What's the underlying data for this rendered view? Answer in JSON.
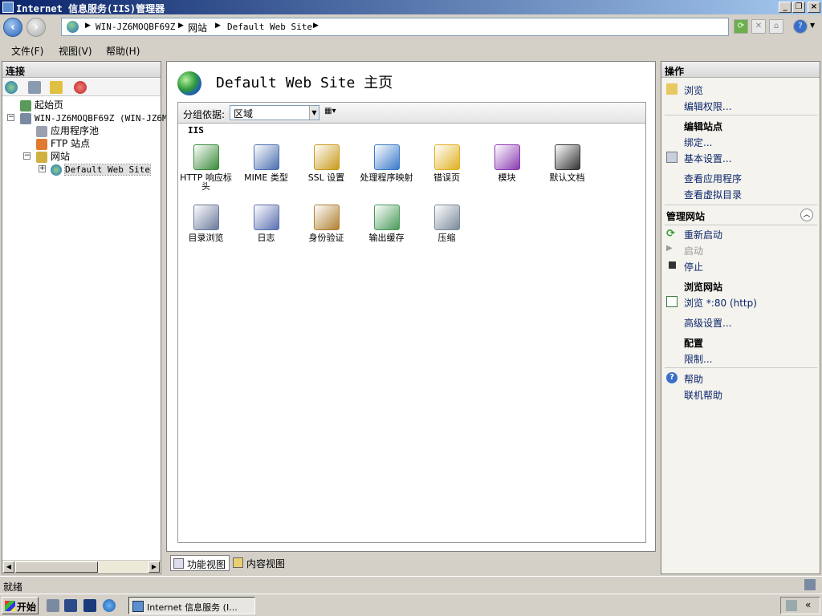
{
  "window": {
    "title": "Internet 信息服务(IIS)管理器"
  },
  "address": {
    "crumbs": [
      "WIN-JZ6MOQBF69Z",
      "网站",
      "Default Web Site"
    ],
    "sep": "▶"
  },
  "menu": {
    "file": "文件(F)",
    "view": "视图(V)",
    "help": "帮助(H)"
  },
  "left": {
    "header": "连接",
    "tree": {
      "start_page": "起始页",
      "server": "WIN-JZ6MOQBF69Z (WIN-JZ6MO",
      "app_pools": "应用程序池",
      "ftp_sites": "FTP 站点",
      "sites": "网站",
      "default_site": "Default Web Site"
    }
  },
  "center": {
    "title": "Default Web Site 主页",
    "group_label": "分组依据:",
    "group_value": "区域",
    "section": "IIS",
    "features": [
      {
        "label": "HTTP 响应标头",
        "icon": "http-response-icon",
        "color": "#3a8a3a"
      },
      {
        "label": "MIME 类型",
        "icon": "mime-icon",
        "color": "#4a6fb0"
      },
      {
        "label": "SSL 设置",
        "icon": "lock-icon",
        "color": "#c89a1a"
      },
      {
        "label": "处理程序映射",
        "icon": "handler-icon",
        "color": "#3a7ac8"
      },
      {
        "label": "错误页",
        "icon": "error-page-icon",
        "color": "#e0b020"
      },
      {
        "label": "模块",
        "icon": "modules-icon",
        "color": "#8a3ab0"
      },
      {
        "label": "默认文档",
        "icon": "default-doc-icon",
        "color": "#333333"
      },
      {
        "label": "目录浏览",
        "icon": "dir-browse-icon",
        "color": "#6a7a9a"
      },
      {
        "label": "日志",
        "icon": "log-icon",
        "color": "#5a6fb0"
      },
      {
        "label": "身份验证",
        "icon": "auth-icon",
        "color": "#b08030"
      },
      {
        "label": "输出缓存",
        "icon": "output-cache-icon",
        "color": "#4a9a5a"
      },
      {
        "label": "压缩",
        "icon": "compress-icon",
        "color": "#7a8a9a"
      }
    ],
    "tabs": {
      "features": "功能视图",
      "content": "内容视图"
    }
  },
  "actions": {
    "header": "操作",
    "browse": "浏览",
    "edit_perms": "编辑权限...",
    "edit_site_head": "编辑站点",
    "bindings": "绑定...",
    "basic_settings": "基本设置...",
    "view_apps": "查看应用程序",
    "view_vdirs": "查看虚拟目录",
    "manage_head": "管理网站",
    "restart": "重新启动",
    "start": "启动",
    "stop": "停止",
    "browse_head": "浏览网站",
    "browse_80": "浏览 *:80 (http)",
    "advanced": "高级设置...",
    "config_head": "配置",
    "limits": "限制...",
    "help": "帮助",
    "online_help": "联机帮助"
  },
  "status": {
    "text": "就绪"
  },
  "taskbar": {
    "start": "开始",
    "task": "Internet 信息服务 (I..."
  },
  "colors": {
    "titlebar": "#0a246a",
    "accent": "#0a246a"
  }
}
